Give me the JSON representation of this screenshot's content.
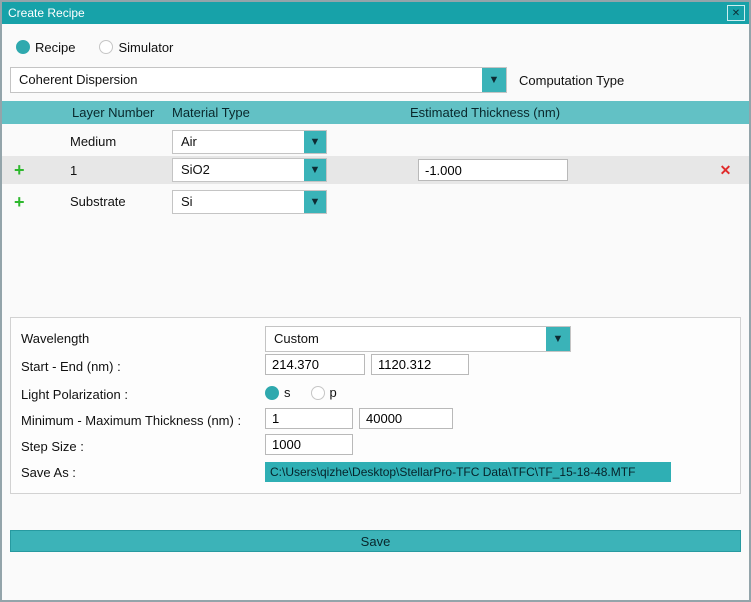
{
  "colors": {
    "titlebar": "#17a2a9",
    "table_header": "#62c1c5",
    "accent_button": "#3ab3b8",
    "save_as_background": "#2fafb4",
    "row_highlight": "#e7e7e7",
    "add_icon": "#2eb82e",
    "delete_icon": "#e02b2b"
  },
  "icons": {
    "dropdown": "▼",
    "close": "✕",
    "add": "+",
    "delete": "✕"
  },
  "window": {
    "title": "Create Recipe"
  },
  "mode": {
    "recipe_label": "Recipe",
    "simulator_label": "Simulator",
    "selected": "Recipe"
  },
  "computation": {
    "value": "Coherent Dispersion",
    "label": "Computation Type"
  },
  "layers": {
    "headers": {
      "layer": "Layer Number",
      "material": "Material Type",
      "thickness": "Estimated Thickness (nm)"
    },
    "rows": [
      {
        "layer": "Medium",
        "material": "Air",
        "thickness": ""
      },
      {
        "layer": "1",
        "material": "SiO2",
        "thickness": "-1.000"
      },
      {
        "layer": "Substrate",
        "material": "Si",
        "thickness": ""
      }
    ]
  },
  "settings": {
    "wavelength_label": "Wavelength",
    "wavelength_value": "Custom",
    "range_label": "Start - End (nm) :",
    "range_start": "214.370",
    "range_end": "1120.312",
    "polarization_label": "Light Polarization :",
    "polarization_s": "s",
    "polarization_p": "p",
    "polarization_selected": "s",
    "minmax_label": "Minimum - Maximum Thickness (nm) :",
    "min_value": "1",
    "max_value": "40000",
    "step_label": "Step Size :",
    "step_value": "1000",
    "save_as_label": "Save As :",
    "save_as_value": "C:\\Users\\qizhe\\Desktop\\StellarPro-TFC Data\\TFC\\TF_15-18-48.MTF"
  },
  "footer": {
    "save_label": "Save"
  }
}
